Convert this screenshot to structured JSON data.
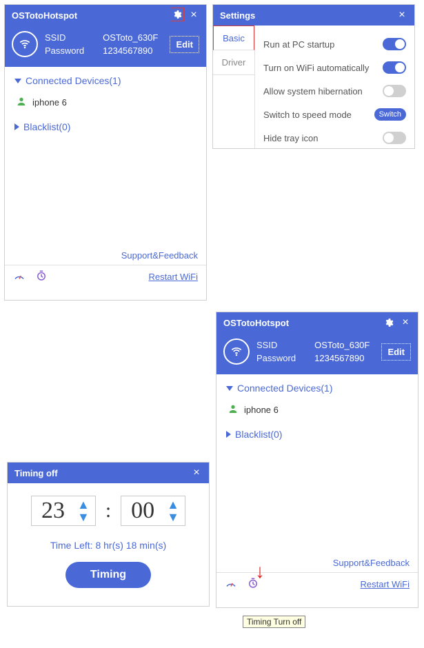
{
  "app": {
    "title": "OSTotoHotspot",
    "edit_label": "Edit",
    "ssid_label": "SSID",
    "ssid_value": "OSToto_630F",
    "password_label": "Password",
    "password_value": "1234567890",
    "connected_devices_label": "Connected Devices(1)",
    "devices": [
      {
        "name": "iphone 6"
      }
    ],
    "blacklist_label": "Blacklist(0)",
    "support_link": "Support&Feedback",
    "restart_link": "Restart WiFi"
  },
  "settings": {
    "title": "Settings",
    "tabs": {
      "basic": "Basic",
      "driver": "Driver"
    },
    "active_tab": "basic",
    "rows": [
      {
        "label": "Run at PC startup",
        "control": "toggle",
        "state": "on"
      },
      {
        "label": "Turn on WiFi automatically",
        "control": "toggle",
        "state": "on"
      },
      {
        "label": "Allow system hibernation",
        "control": "toggle",
        "state": "off"
      },
      {
        "label": "Switch to speed mode",
        "control": "switch_pill",
        "pill_text": "Switch"
      },
      {
        "label": "Hide tray icon",
        "control": "toggle",
        "state": "off"
      }
    ]
  },
  "timing": {
    "title": "Timing off",
    "hours": "23",
    "minutes": "00",
    "time_left": "Time Left: 8 hr(s) 18 min(s)",
    "button": "Timing"
  },
  "tooltip": {
    "text": "Timing Turn off"
  },
  "annotations": {
    "gear_highlight": true,
    "basic_tab_highlight": true,
    "arrow_to_timer_icon": true
  }
}
